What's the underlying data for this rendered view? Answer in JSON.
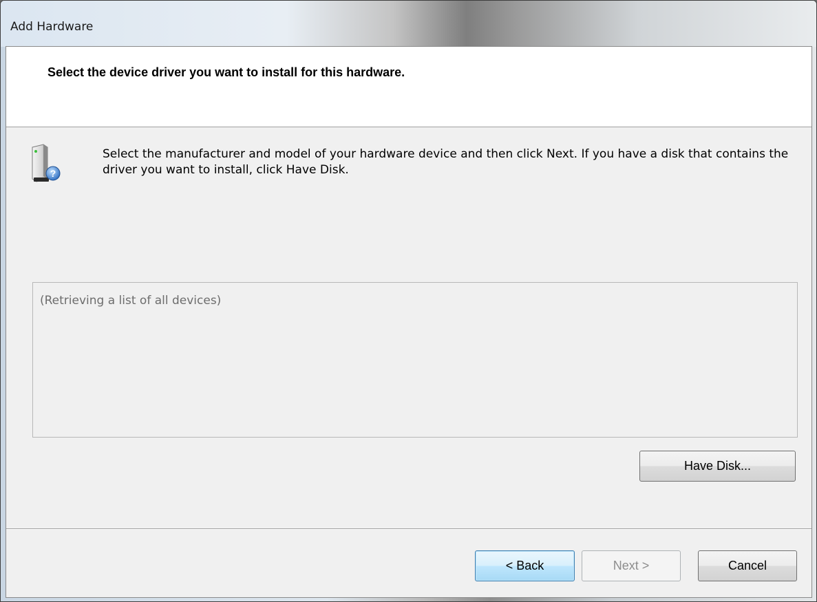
{
  "window": {
    "title": "Add Hardware"
  },
  "header": {
    "title": "Select the device driver you want to install for this hardware."
  },
  "intro": {
    "text": "Select the manufacturer and model of your hardware device and then click Next. If you have a disk that contains the driver you want to install, click Have Disk.",
    "icon": "hardware-device-question-icon"
  },
  "device_list": {
    "status_text": "(Retrieving a list of all devices)"
  },
  "buttons": {
    "have_disk": "Have Disk...",
    "back": "< Back",
    "next": "Next >",
    "cancel": "Cancel"
  },
  "colors": {
    "client_bg": "#f0f0f0",
    "header_bg": "#ffffff",
    "default_button_border": "#3c7fb1",
    "disabled_text": "#8d8d8d"
  }
}
